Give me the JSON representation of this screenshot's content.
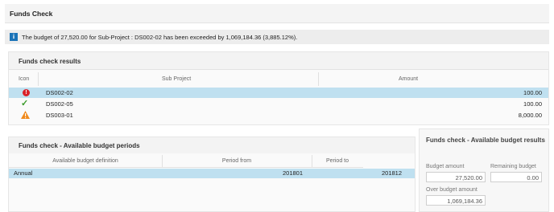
{
  "header": {
    "title": "Funds Check"
  },
  "message": {
    "icon": "info-icon",
    "text": "The budget of 27,520.00 for Sub-Project : DS002-02 has been exceeded by 1,069,184.36 (3,885.12%)."
  },
  "results": {
    "title": "Funds check results",
    "columns": {
      "icon": "Icon",
      "sub_project": "Sub Project",
      "amount": "Amount"
    },
    "rows": [
      {
        "icon": "error-icon",
        "sub_project": "DS002-02",
        "amount": "100.00",
        "selected": true
      },
      {
        "icon": "checkmark-icon",
        "sub_project": "DS002-05",
        "amount": "100.00",
        "selected": false
      },
      {
        "icon": "warning-icon",
        "sub_project": "DS003-01",
        "amount": "8,000.00",
        "selected": false
      }
    ]
  },
  "periods": {
    "title": "Funds check - Available budget periods",
    "columns": {
      "definition": "Available budget definition",
      "from": "Period from",
      "to": "Period to"
    },
    "rows": [
      {
        "definition": "Annual",
        "from": "201801",
        "to": "201812"
      }
    ]
  },
  "budget_results": {
    "title": "Funds check - Available budget results",
    "budget_amount_label": "Budget amount",
    "budget_amount": "27,520.00",
    "remaining_budget_label": "Remaining budget",
    "remaining_budget": "0.00",
    "over_budget_label": "Over budget amount",
    "over_budget": "1,069,184.36"
  },
  "colors": {
    "selected_row": "#bfe0f0",
    "info": "#1a73b8",
    "error": "#d9222a",
    "success": "#3a9a2a",
    "warning": "#f08a1c"
  }
}
